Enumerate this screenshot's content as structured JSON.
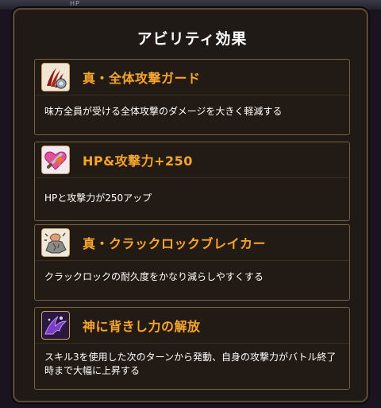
{
  "background": {
    "hp_label": "HP"
  },
  "dialog": {
    "title": "アビリティ効果",
    "abilities": [
      {
        "name": "真・全体攻撃ガード",
        "description": "味方全員が受ける全体攻撃のダメージを大きく軽減する",
        "icon": "claw-shield-icon"
      },
      {
        "name": "HP&攻撃力+250",
        "description": "HPと攻撃力が250アップ",
        "icon": "heart-sword-icon"
      },
      {
        "name": "真・クラックロックブレイカー",
        "description": "クラックロックの耐久度をかなり減らしやすくする",
        "icon": "rock-fist-icon"
      },
      {
        "name": "神に背きし力の解放",
        "description": "スキル3を使用した次のターンから発動、自身の攻撃力がバトル終了時まで大幅に上昇する",
        "icon": "dark-power-icon"
      }
    ]
  },
  "colors": {
    "accent": "#f0a732",
    "card_border": "#7a6040",
    "panel_bg": "#1f1a16"
  }
}
